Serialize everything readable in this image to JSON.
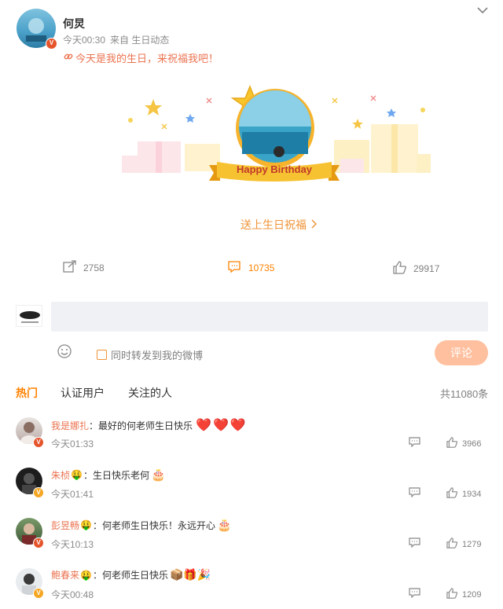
{
  "post": {
    "author": "何炅",
    "meta_time": "今天00:30",
    "meta_source": "来自 生日动态",
    "content": "今天是我的生日，来祝福我吧！",
    "card_banner_text": "Happy Birthday",
    "send_wish": "送上生日祝福",
    "forward_count": "2758",
    "comment_count": "10735",
    "like_count": "29917"
  },
  "composer": {
    "placeholder": "",
    "sync_label": "同时转发到我的微博",
    "submit_label": "评论"
  },
  "comments_header": {
    "tabs": [
      {
        "label": "热门",
        "active": true
      },
      {
        "label": "认证用户",
        "active": false
      },
      {
        "label": "关注的人",
        "active": false
      }
    ],
    "total": "共11080条"
  },
  "comments": [
    {
      "name": "我是娜扎",
      "text": "：最好的何老师生日快乐",
      "emoji": "❤️❤️❤️",
      "time": "今天01:33",
      "likes": "3966",
      "badge": "red"
    },
    {
      "name": "朱桢",
      "text": "：生日快乐老何",
      "emoji": "🎂",
      "time": "今天01:41",
      "likes": "1934",
      "badge": "gold"
    },
    {
      "name": "彭昱畅",
      "text": "：何老师生日快乐！永远开心",
      "emoji": "🎂",
      "time": "今天10:13",
      "likes": "1279",
      "badge": "red"
    },
    {
      "name": "鲍春来",
      "text": "：何老师生日快乐",
      "emoji": "📦🎁🎉",
      "time": "今天00:48",
      "likes": "1209",
      "badge": "gold"
    }
  ],
  "colors": {
    "accent": "#ff8200",
    "link": "#eb7350",
    "submit_bg": "#ffc09f",
    "input_bg": "#f0f1f4"
  }
}
